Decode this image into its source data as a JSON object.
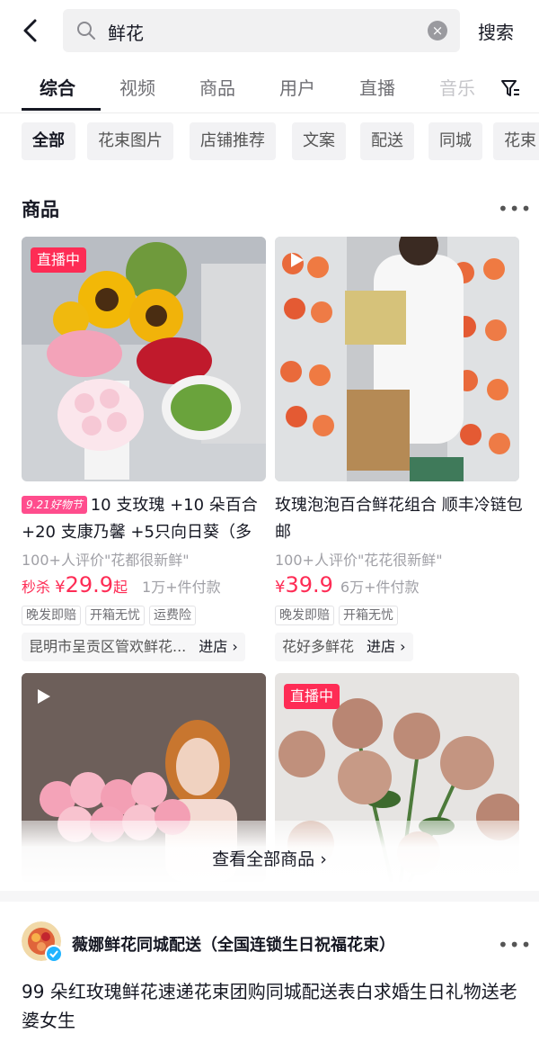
{
  "search": {
    "query": "鲜花",
    "action": "搜索"
  },
  "tabs": [
    {
      "label": "综合",
      "active": true
    },
    {
      "label": "视频"
    },
    {
      "label": "商品"
    },
    {
      "label": "用户"
    },
    {
      "label": "直播"
    },
    {
      "label": "音乐"
    }
  ],
  "chips": [
    "全部",
    "花束图片",
    "店铺推荐",
    "文案",
    "配送",
    "同城",
    "花束"
  ],
  "section": {
    "title": "商品"
  },
  "products": [
    {
      "badge": "直播中",
      "promo_tag": "9.21好物节",
      "title": "10 支玫瑰 +10 朵百合 +20 支康乃馨 +5只向日葵（多",
      "reviews": "100+人评价\"花都很新鲜\"",
      "flash_label": "秒杀",
      "currency": "¥",
      "price": "29.9",
      "price_suffix": "起",
      "sold": "1万+件付款",
      "tags": [
        "晚发即赔",
        "开箱无忧",
        "运费险"
      ],
      "store": "昆明市呈贡区管欢鲜花...",
      "enter": "进店 ›"
    },
    {
      "title": "玫瑰泡泡百合鲜花组合 顺丰冷链包邮",
      "reviews": "100+人评价\"花花很新鲜\"",
      "currency": "¥",
      "price": "39.9",
      "sold": "6万+件付款",
      "tags": [
        "晚发即赔",
        "开箱无忧"
      ],
      "store": "花好多鲜花",
      "enter": "进店 ›"
    }
  ],
  "products_row2": [
    {},
    {
      "badge": "直播中"
    }
  ],
  "view_all": "查看全部商品 ›",
  "store_result": {
    "name": "薇娜鲜花同城配送（全国连锁生日祝福花束）",
    "description": "99 朵红玫瑰鲜花速递花束团购同城配送表白求婚生日礼物送老婆女生"
  },
  "colors": {
    "accent": "#fe2c55",
    "verified": "#20b4ff"
  }
}
